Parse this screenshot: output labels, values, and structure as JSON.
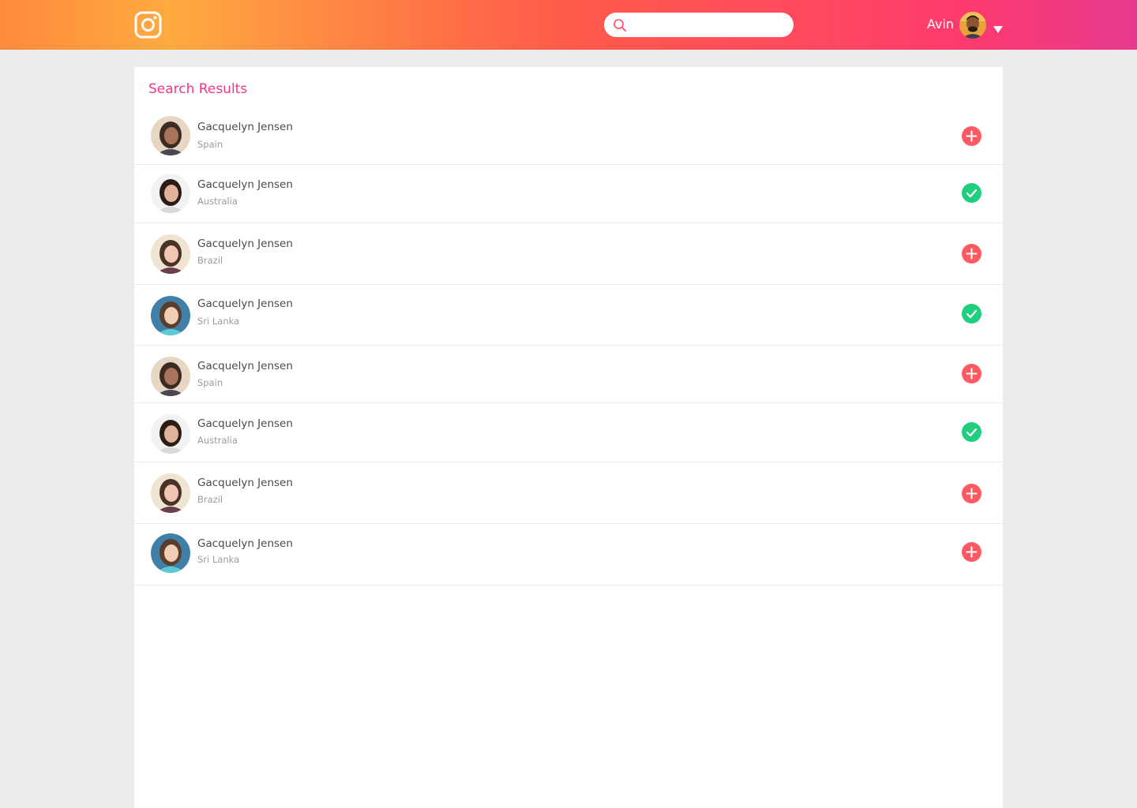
{
  "header": {
    "user_name": "Avin",
    "search": {
      "value": "",
      "placeholder": ""
    }
  },
  "colors": {
    "accent": "#f0378a",
    "add": "#ff5a64",
    "added": "#1fcf7e"
  },
  "icons": {
    "logo": "instagram-logo-icon",
    "search": "search-icon",
    "caret": "caret-down-icon",
    "add": "plus-icon",
    "added": "check-icon"
  },
  "results": {
    "title": "Search Results",
    "items": [
      {
        "name": "Gacquelyn Jensen",
        "country": "Spain",
        "status": "add"
      },
      {
        "name": "Gacquelyn Jensen",
        "country": "Australia",
        "status": "added"
      },
      {
        "name": "Gacquelyn Jensen",
        "country": "Brazil",
        "status": "add"
      },
      {
        "name": "Gacquelyn Jensen",
        "country": "Sri Lanka",
        "status": "added"
      },
      {
        "name": "Gacquelyn Jensen",
        "country": "Spain",
        "status": "add"
      },
      {
        "name": "Gacquelyn Jensen",
        "country": "Australia",
        "status": "added"
      },
      {
        "name": "Gacquelyn Jensen",
        "country": "Brazil",
        "status": "add"
      },
      {
        "name": "Gacquelyn Jensen",
        "country": "Sri Lanka",
        "status": "add"
      }
    ]
  }
}
